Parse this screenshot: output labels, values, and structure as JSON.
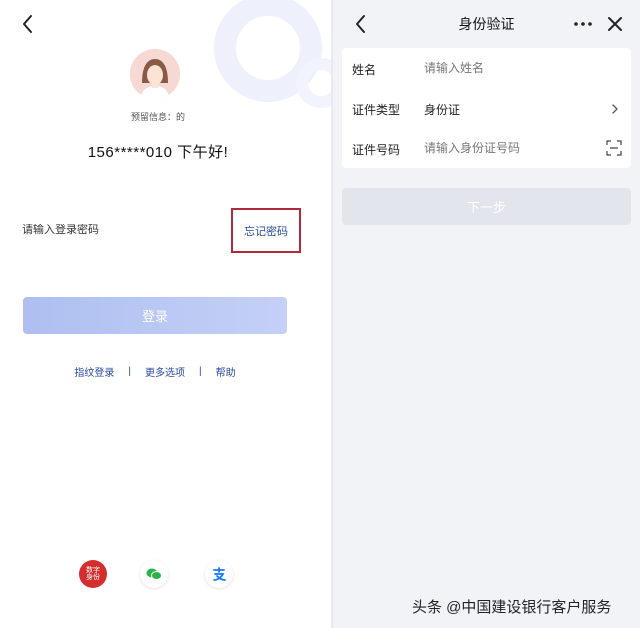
{
  "login": {
    "reserved_info": "预留信息：的",
    "greeting": "156*****010  下午好!",
    "password_placeholder": "请输入登录密码",
    "forgot_password": "忘记密码",
    "login_button": "登录",
    "links": [
      "指纹登录",
      "更多选项",
      "帮助"
    ],
    "separator": "|",
    "digital_badge": "数字身份"
  },
  "verify": {
    "title": "身份验证",
    "fields": [
      {
        "label": "姓名",
        "placeholder": "请输入姓名"
      },
      {
        "label": "证件类型",
        "value": "身份证"
      },
      {
        "label": "证件号码",
        "placeholder": "请输入身份证号码"
      }
    ],
    "next_button": "下一步"
  },
  "watermark": "头条 @中国建设银行客户服务",
  "colors": {
    "accent_blue": "#2a4a9e",
    "highlight_border": "#b02a3c",
    "login_button": "#b9c7f3",
    "next_button_disabled": "#e2e5ec",
    "right_background": "#f2f3f7"
  },
  "icons": [
    "back-arrow-icon",
    "user-avatar-icon",
    "digital-id-icon",
    "wechat-icon",
    "alipay-icon",
    "more-icon",
    "close-icon",
    "chevron-right-icon",
    "scan-icon"
  ]
}
